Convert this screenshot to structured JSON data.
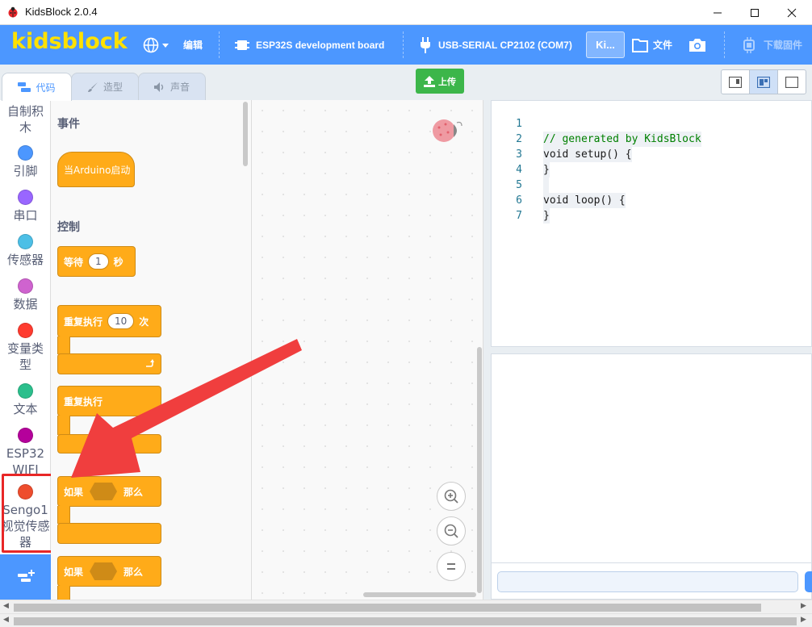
{
  "window": {
    "title": "KidsBlock 2.0.4"
  },
  "menu": {
    "logo": "kidsblock",
    "edit": "编辑",
    "board": "ESP32S development board",
    "port": "USB-SERIAL CP2102 (COM7)",
    "kits": "Ki...",
    "file": "文件",
    "download_firmware": "下载固件"
  },
  "tabs": [
    {
      "label": "代码",
      "active": true
    },
    {
      "label": "造型",
      "active": false
    },
    {
      "label": "声音",
      "active": false
    }
  ],
  "toolbar": {
    "upload": "上传"
  },
  "categories": [
    {
      "label": "自制积木",
      "color": ""
    },
    {
      "label": "引脚",
      "color": "#4c97ff"
    },
    {
      "label": "串口",
      "color": "#9966ff"
    },
    {
      "label": "传感器",
      "color": "#4cbfe6"
    },
    {
      "label": "数据",
      "color": "#cf63cf"
    },
    {
      "label": "变量类型",
      "color": "#ff3b2f"
    },
    {
      "label": "文本",
      "color": "#2bbf8c"
    },
    {
      "label": "ESP32 WIFI",
      "color": "#b5009b"
    },
    {
      "label": "Sengo1视觉传感器",
      "color": "#ee4d2d"
    }
  ],
  "palette": {
    "events_label": "事件",
    "when_start": "当Arduino启动",
    "control_label": "控制",
    "wait_prefix": "等待",
    "wait_value": "1",
    "wait_suffix": "秒",
    "repeat_prefix": "重复执行",
    "repeat_value": "10",
    "repeat_suffix": "次",
    "forever": "重复执行",
    "if_prefix": "如果",
    "if_then": "那么",
    "if2_prefix": "如果",
    "if2_then": "那么"
  },
  "code": {
    "lines": [
      {
        "n": "1",
        "text": "// generated by KidsBlock"
      },
      {
        "n": "2",
        "text": "void setup() {"
      },
      {
        "n": "3",
        "text": "}"
      },
      {
        "n": "4",
        "text": ""
      },
      {
        "n": "5",
        "text": "void loop() {"
      },
      {
        "n": "6",
        "text": "}"
      },
      {
        "n": "7",
        "text": ""
      }
    ]
  },
  "colors": {
    "accent": "#4c97ff",
    "logo": "#ffe100",
    "block_control": "#ffab19",
    "upload": "#3cb64a",
    "highlight": "#e82727",
    "arrow": "#f03e3e"
  }
}
